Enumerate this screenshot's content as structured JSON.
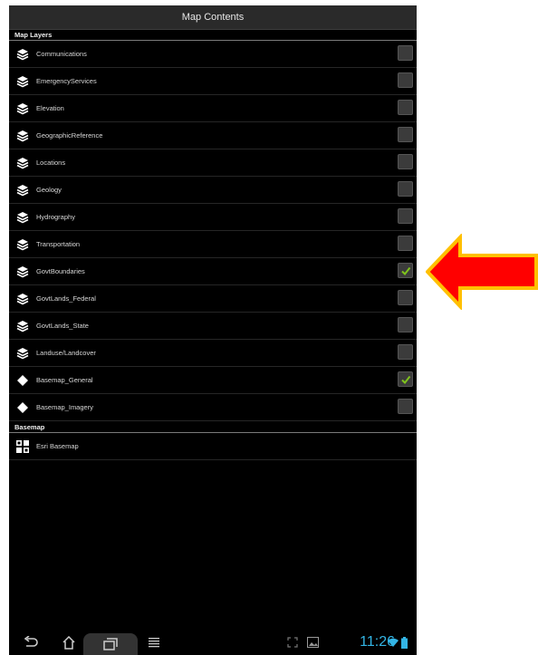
{
  "title": "Map Contents",
  "sections": {
    "layers_header": "Map Layers",
    "basemap_header": "Basemap"
  },
  "layers": [
    {
      "label": "Communications",
      "icon": "layers-icon",
      "checked": false
    },
    {
      "label": "EmergencyServices",
      "icon": "layers-icon",
      "checked": false
    },
    {
      "label": "Elevation",
      "icon": "layers-icon",
      "checked": false
    },
    {
      "label": "GeographicReference",
      "icon": "layers-icon",
      "checked": false
    },
    {
      "label": "Locations",
      "icon": "layers-icon",
      "checked": false
    },
    {
      "label": "Geology",
      "icon": "layers-icon",
      "checked": false
    },
    {
      "label": "Hydrography",
      "icon": "layers-icon",
      "checked": false
    },
    {
      "label": "Transportation",
      "icon": "layers-icon",
      "checked": false
    },
    {
      "label": "GovtBoundaries",
      "icon": "layers-icon",
      "checked": true
    },
    {
      "label": "GovtLands_Federal",
      "icon": "layers-icon",
      "checked": false
    },
    {
      "label": "GovtLands_State",
      "icon": "layers-icon",
      "checked": false
    },
    {
      "label": "Landuse/Landcover",
      "icon": "layers-icon",
      "checked": false
    },
    {
      "label": "Basemap_General",
      "icon": "diamond-icon",
      "checked": true
    },
    {
      "label": "Basemap_Imagery",
      "icon": "diamond-icon",
      "checked": false
    }
  ],
  "basemap": {
    "label": "Esri Basemap",
    "icon": "basemap-grid-icon"
  },
  "statusbar": {
    "time": "11:26"
  },
  "colors": {
    "check": "#7fc31c",
    "clock": "#33b5e5",
    "arrow_fill": "#ff0000",
    "arrow_border": "#ffc000"
  }
}
